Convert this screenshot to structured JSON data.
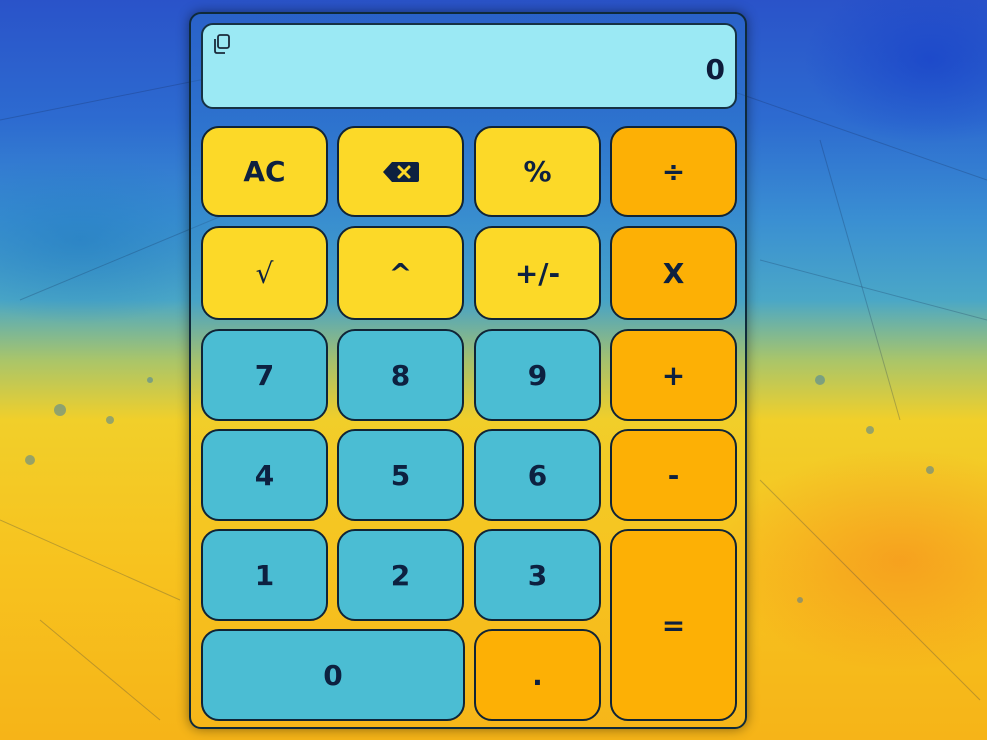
{
  "display": {
    "value": "0"
  },
  "keys": {
    "clear": "AC",
    "backspace": "",
    "percent": "%",
    "divide": "÷",
    "sqrt": "√",
    "power": "^",
    "negate": "+/-",
    "multiply": "X",
    "seven": "7",
    "eight": "8",
    "nine": "9",
    "plus": "+",
    "four": "4",
    "five": "5",
    "six": "6",
    "minus": "-",
    "one": "1",
    "two": "2",
    "three": "3",
    "equals": "=",
    "zero": "0",
    "decimal": "."
  },
  "icons": {
    "copy": "copy-icon",
    "backspace": "backspace-icon"
  },
  "colors": {
    "display_bg": "#9be9f4",
    "function_key": "#fcd928",
    "operator_key": "#fdb005",
    "digit_key": "#4bbdd3",
    "key_text": "#0d2140"
  }
}
